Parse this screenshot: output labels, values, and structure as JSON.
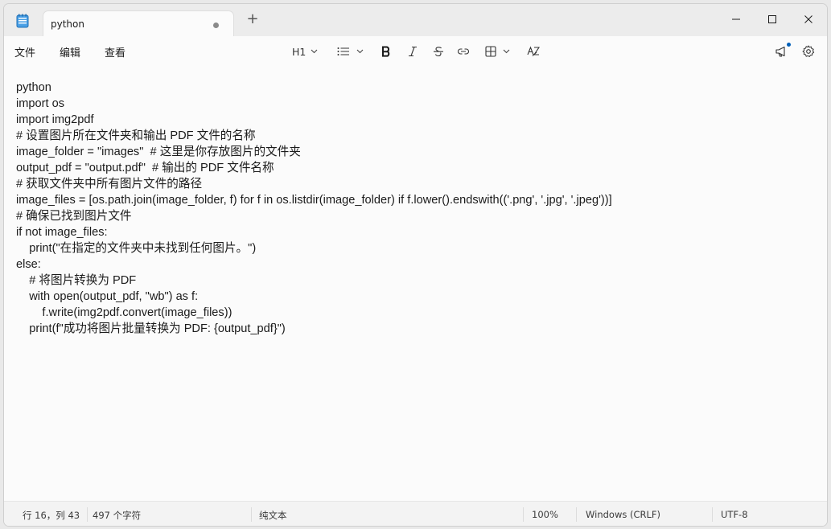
{
  "window": {
    "tab_title": "python",
    "new_tab_symbol": "+"
  },
  "menu": {
    "file": "文件",
    "edit": "编辑",
    "view": "查看"
  },
  "toolbar": {
    "heading_label": "H1",
    "icons": [
      "list-icon",
      "bold-icon",
      "italic-icon",
      "strikethrough-icon",
      "link-icon",
      "table-icon",
      "spellcheck-icon",
      "whats-new-icon",
      "settings-icon"
    ]
  },
  "editor": {
    "lines": [
      "python",
      "import os",
      "import img2pdf",
      "# 设置图片所在文件夹和输出 PDF 文件的名称",
      "image_folder = \"images\"  # 这里是你存放图片的文件夹",
      "output_pdf = \"output.pdf\"  # 输出的 PDF 文件名称",
      "# 获取文件夹中所有图片文件的路径",
      "image_files = [os.path.join(image_folder, f) for f in os.listdir(image_folder) if f.lower().endswith(('.png', '.jpg', '.jpeg'))]",
      "# 确保已找到图片文件",
      "if not image_files:",
      "    print(\"在指定的文件夹中未找到任何图片。\")",
      "else:",
      "    # 将图片转换为 PDF",
      "    with open(output_pdf, \"wb\") as f:",
      "        f.write(img2pdf.convert(image_files))",
      "    print(f\"成功将图片批量转换为 PDF: {output_pdf}\")"
    ]
  },
  "status": {
    "position": "行 16，列 43",
    "char_count": "497 个字符",
    "format": "纯文本",
    "zoom": "100%",
    "line_ending": "Windows (CRLF)",
    "encoding": "UTF-8"
  },
  "colors": {
    "accent": "#005fb8",
    "window_bg": "#f3f3f3",
    "editor_bg": "#fbfbfb",
    "text": "#1b1b1b"
  }
}
